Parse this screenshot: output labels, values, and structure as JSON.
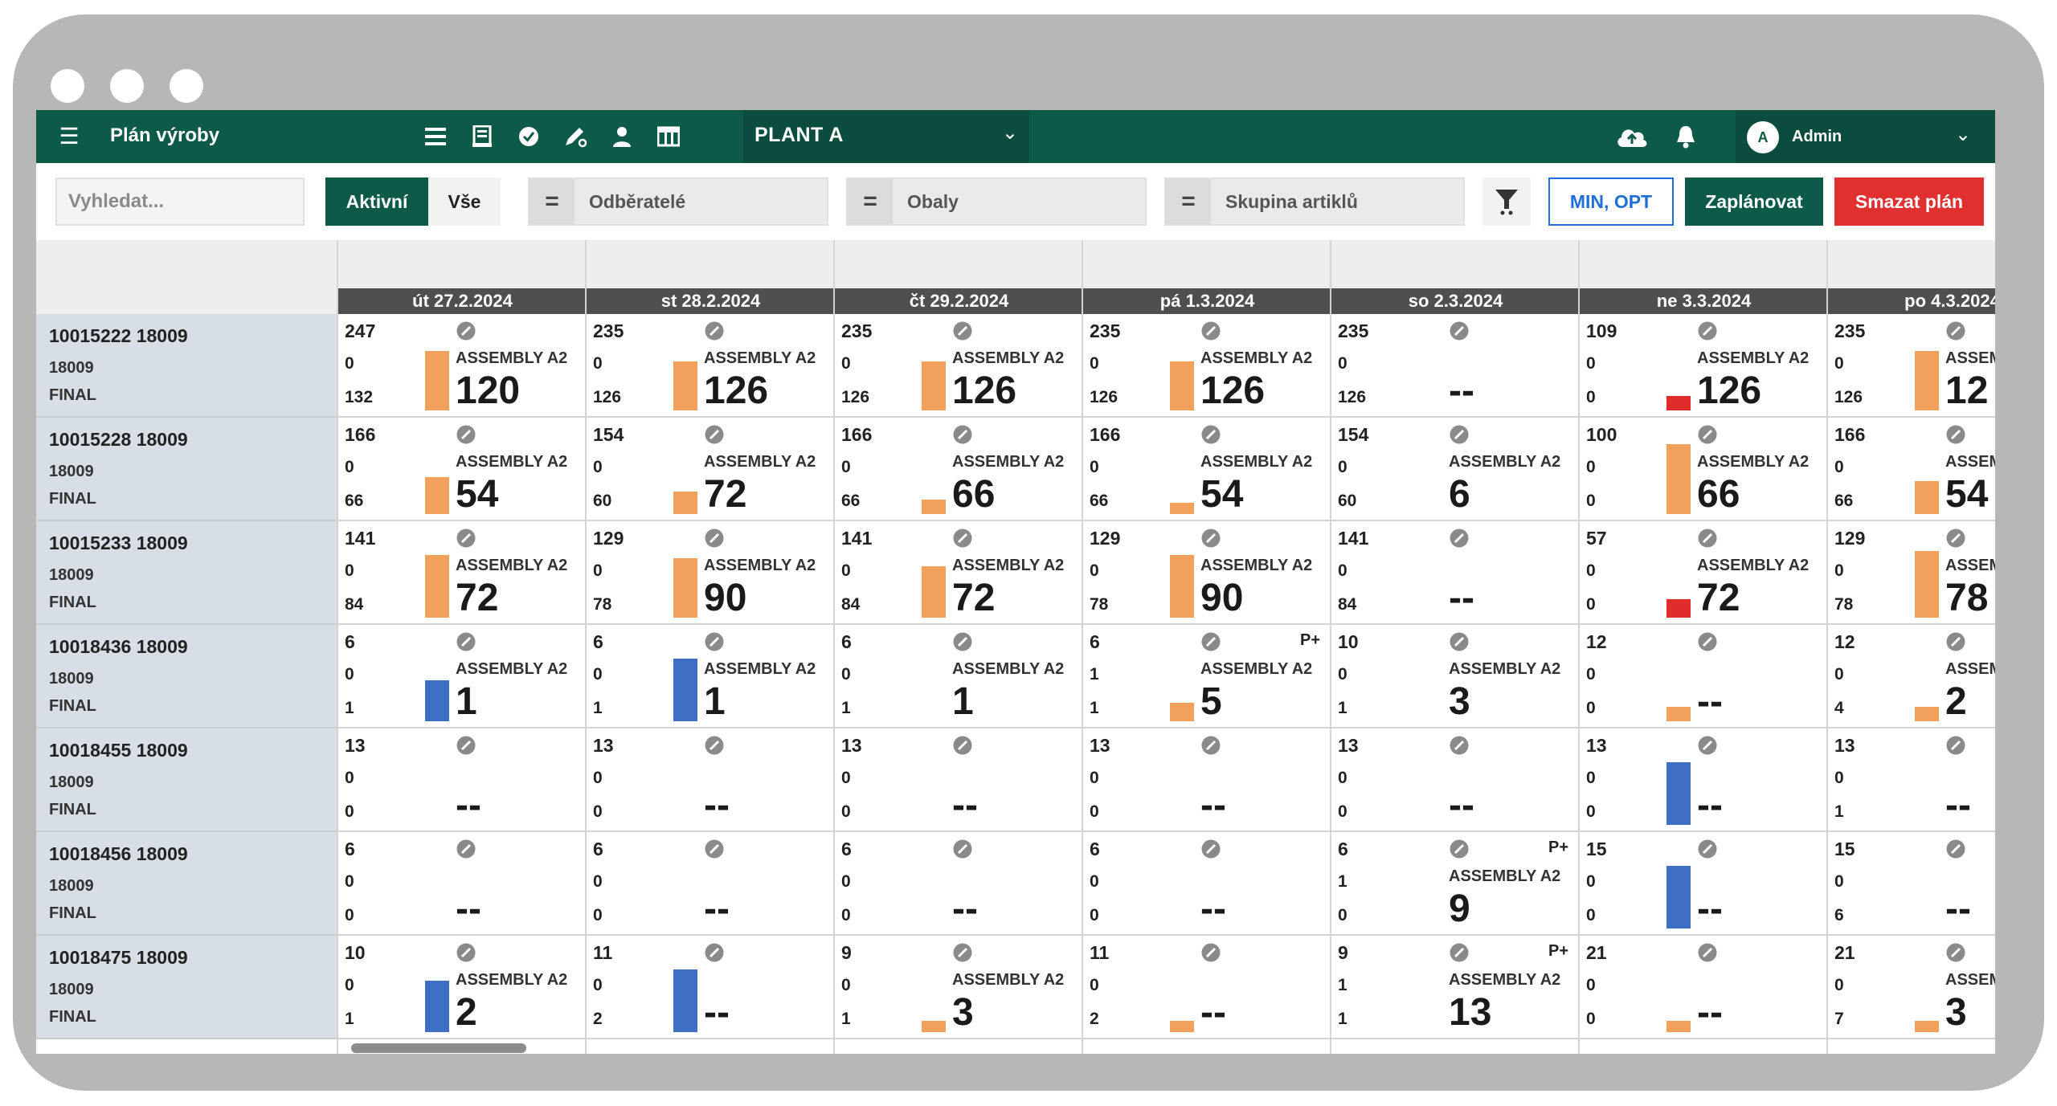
{
  "header": {
    "menu_icon": "hamburger-menu-icon",
    "title": "Plán výroby",
    "toolbar_icons": [
      "list-icon",
      "document-icon",
      "check-circle-icon",
      "edit-pen-icon",
      "user-icon",
      "table-icon"
    ],
    "plant": "PLANT A",
    "cloud_icon": "cloud-upload-icon",
    "bell_icon": "bell-icon",
    "user_initial": "A",
    "user_name": "Admin"
  },
  "toolbar": {
    "search_placeholder": "Vyhledat...",
    "active_label": "Aktivní",
    "all_label": "Vše",
    "filter_customers": "Odběratelé",
    "filter_packaging": "Obaly",
    "filter_group": "Skupina artiklů",
    "minopt_label": "MIN, OPT",
    "plan_label": "Zaplánovat",
    "delete_label": "Smazat plán"
  },
  "colors": {
    "primary_green": "#0e5a49",
    "orange": "#f2a15d",
    "blue": "#3f6fc4",
    "red": "#e02b2b",
    "danger_button": "#e03030",
    "outline_blue": "#1f6fd6"
  },
  "days": [
    "út 27.2.2024",
    "st 28.2.2024",
    "čt 29.2.2024",
    "pá 1.3.2024",
    "so 2.3.2024",
    "ne 3.3.2024",
    "po 4.3.2024"
  ],
  "rows": [
    {
      "id": "10015222 18009",
      "sub": "18009",
      "type": "FINAL",
      "cells": [
        {
          "a": "247",
          "b": "0",
          "c": "132",
          "asm": "ASSEMBLY A2",
          "big": "120",
          "bar": "orange",
          "level": 0.8,
          "pplus": ""
        },
        {
          "a": "235",
          "b": "0",
          "c": "126",
          "asm": "ASSEMBLY A2",
          "big": "126",
          "bar": "orange",
          "level": 0.66,
          "pplus": ""
        },
        {
          "a": "235",
          "b": "0",
          "c": "126",
          "asm": "ASSEMBLY A2",
          "big": "126",
          "bar": "orange",
          "level": 0.66,
          "pplus": ""
        },
        {
          "a": "235",
          "b": "0",
          "c": "126",
          "asm": "ASSEMBLY A2",
          "big": "126",
          "bar": "orange",
          "level": 0.66,
          "pplus": ""
        },
        {
          "a": "235",
          "b": "0",
          "c": "126",
          "asm": "",
          "big": "--",
          "bar": "",
          "level": 0,
          "pplus": ""
        },
        {
          "a": "109",
          "b": "0",
          "c": "0",
          "asm": "ASSEMBLY A2",
          "big": "126",
          "bar": "red",
          "level": 0.2,
          "pplus": ""
        },
        {
          "a": "235",
          "b": "0",
          "c": "126",
          "asm": "ASSEM",
          "big": "12",
          "bar": "orange",
          "level": 0.8,
          "pplus": ""
        }
      ]
    },
    {
      "id": "10015228 18009",
      "sub": "18009",
      "type": "FINAL",
      "cells": [
        {
          "a": "166",
          "b": "0",
          "c": "66",
          "asm": "ASSEMBLY A2",
          "big": "54",
          "bar": "orange",
          "level": 0.5,
          "pplus": ""
        },
        {
          "a": "154",
          "b": "0",
          "c": "60",
          "asm": "ASSEMBLY A2",
          "big": "72",
          "bar": "orange",
          "level": 0.3,
          "pplus": ""
        },
        {
          "a": "166",
          "b": "0",
          "c": "66",
          "asm": "ASSEMBLY A2",
          "big": "66",
          "bar": "orange",
          "level": 0.2,
          "pplus": ""
        },
        {
          "a": "166",
          "b": "0",
          "c": "66",
          "asm": "ASSEMBLY A2",
          "big": "54",
          "bar": "orange",
          "level": 0.15,
          "pplus": ""
        },
        {
          "a": "154",
          "b": "0",
          "c": "60",
          "asm": "ASSEMBLY A2",
          "big": "6",
          "bar": "",
          "level": 0,
          "pplus": ""
        },
        {
          "a": "100",
          "b": "0",
          "c": "0",
          "asm": "ASSEMBLY A2",
          "big": "66",
          "bar": "orange",
          "level": 0.95,
          "pplus": ""
        },
        {
          "a": "166",
          "b": "0",
          "c": "66",
          "asm": "ASSEM",
          "big": "54",
          "bar": "orange",
          "level": 0.45,
          "pplus": ""
        }
      ]
    },
    {
      "id": "10015233 18009",
      "sub": "18009",
      "type": "FINAL",
      "cells": [
        {
          "a": "141",
          "b": "0",
          "c": "84",
          "asm": "ASSEMBLY A2",
          "big": "72",
          "bar": "orange",
          "level": 0.85,
          "pplus": ""
        },
        {
          "a": "129",
          "b": "0",
          "c": "78",
          "asm": "ASSEMBLY A2",
          "big": "90",
          "bar": "orange",
          "level": 0.8,
          "pplus": ""
        },
        {
          "a": "141",
          "b": "0",
          "c": "84",
          "asm": "ASSEMBLY A2",
          "big": "72",
          "bar": "orange",
          "level": 0.7,
          "pplus": ""
        },
        {
          "a": "129",
          "b": "0",
          "c": "78",
          "asm": "ASSEMBLY A2",
          "big": "90",
          "bar": "orange",
          "level": 0.85,
          "pplus": ""
        },
        {
          "a": "141",
          "b": "0",
          "c": "84",
          "asm": "",
          "big": "--",
          "bar": "",
          "level": 0,
          "pplus": ""
        },
        {
          "a": "57",
          "b": "0",
          "c": "0",
          "asm": "ASSEMBLY A2",
          "big": "72",
          "bar": "red",
          "level": 0.25,
          "pplus": ""
        },
        {
          "a": "129",
          "b": "0",
          "c": "78",
          "asm": "ASSEM",
          "big": "78",
          "bar": "orange",
          "level": 0.9,
          "pplus": ""
        }
      ]
    },
    {
      "id": "10018436 18009",
      "sub": "18009",
      "type": "FINAL",
      "cells": [
        {
          "a": "6",
          "b": "0",
          "c": "1",
          "asm": "ASSEMBLY A2",
          "big": "1",
          "bar": "blue",
          "level": 0.55,
          "pplus": ""
        },
        {
          "a": "6",
          "b": "0",
          "c": "1",
          "asm": "ASSEMBLY A2",
          "big": "1",
          "bar": "blue",
          "level": 0.85,
          "pplus": ""
        },
        {
          "a": "6",
          "b": "0",
          "c": "1",
          "asm": "ASSEMBLY A2",
          "big": "1",
          "bar": "",
          "level": 0,
          "pplus": ""
        },
        {
          "a": "6",
          "b": "1",
          "c": "1",
          "asm": "ASSEMBLY A2",
          "big": "5",
          "bar": "orange",
          "level": 0.25,
          "pplus": "P+"
        },
        {
          "a": "10",
          "b": "0",
          "c": "1",
          "asm": "ASSEMBLY A2",
          "big": "3",
          "bar": "",
          "level": 0,
          "pplus": ""
        },
        {
          "a": "12",
          "b": "0",
          "c": "0",
          "asm": "",
          "big": "--",
          "bar": "orange",
          "level": 0.2,
          "pplus": ""
        },
        {
          "a": "12",
          "b": "0",
          "c": "4",
          "asm": "ASSEM",
          "big": "2",
          "bar": "orange",
          "level": 0.2,
          "pplus": ""
        }
      ]
    },
    {
      "id": "10018455 18009",
      "sub": "18009",
      "type": "FINAL",
      "cells": [
        {
          "a": "13",
          "b": "0",
          "c": "0",
          "asm": "",
          "big": "--",
          "bar": "",
          "level": 0,
          "pplus": ""
        },
        {
          "a": "13",
          "b": "0",
          "c": "0",
          "asm": "",
          "big": "--",
          "bar": "",
          "level": 0,
          "pplus": ""
        },
        {
          "a": "13",
          "b": "0",
          "c": "0",
          "asm": "",
          "big": "--",
          "bar": "",
          "level": 0,
          "pplus": ""
        },
        {
          "a": "13",
          "b": "0",
          "c": "0",
          "asm": "",
          "big": "--",
          "bar": "",
          "level": 0,
          "pplus": ""
        },
        {
          "a": "13",
          "b": "0",
          "c": "0",
          "asm": "",
          "big": "--",
          "bar": "",
          "level": 0,
          "pplus": ""
        },
        {
          "a": "13",
          "b": "0",
          "c": "0",
          "asm": "",
          "big": "--",
          "bar": "blue",
          "level": 0.85,
          "pplus": ""
        },
        {
          "a": "13",
          "b": "0",
          "c": "1",
          "asm": "",
          "big": "--",
          "bar": "",
          "level": 0,
          "pplus": ""
        }
      ]
    },
    {
      "id": "10018456 18009",
      "sub": "18009",
      "type": "FINAL",
      "cells": [
        {
          "a": "6",
          "b": "0",
          "c": "0",
          "asm": "",
          "big": "--",
          "bar": "",
          "level": 0,
          "pplus": ""
        },
        {
          "a": "6",
          "b": "0",
          "c": "0",
          "asm": "",
          "big": "--",
          "bar": "",
          "level": 0,
          "pplus": ""
        },
        {
          "a": "6",
          "b": "0",
          "c": "0",
          "asm": "",
          "big": "--",
          "bar": "",
          "level": 0,
          "pplus": ""
        },
        {
          "a": "6",
          "b": "0",
          "c": "0",
          "asm": "",
          "big": "--",
          "bar": "",
          "level": 0,
          "pplus": ""
        },
        {
          "a": "6",
          "b": "1",
          "c": "0",
          "asm": "ASSEMBLY A2",
          "big": "9",
          "bar": "",
          "level": 0,
          "pplus": "P+"
        },
        {
          "a": "15",
          "b": "0",
          "c": "0",
          "asm": "",
          "big": "--",
          "bar": "blue",
          "level": 0.85,
          "pplus": ""
        },
        {
          "a": "15",
          "b": "0",
          "c": "6",
          "asm": "",
          "big": "--",
          "bar": "",
          "level": 0,
          "pplus": ""
        }
      ]
    },
    {
      "id": "10018475 18009",
      "sub": "18009",
      "type": "FINAL",
      "cells": [
        {
          "a": "10",
          "b": "0",
          "c": "1",
          "asm": "ASSEMBLY A2",
          "big": "2",
          "bar": "blue",
          "level": 0.7,
          "pplus": ""
        },
        {
          "a": "11",
          "b": "0",
          "c": "2",
          "asm": "",
          "big": "--",
          "bar": "blue",
          "level": 0.85,
          "pplus": ""
        },
        {
          "a": "9",
          "b": "0",
          "c": "1",
          "asm": "ASSEMBLY A2",
          "big": "3",
          "bar": "orange",
          "level": 0.15,
          "pplus": ""
        },
        {
          "a": "11",
          "b": "0",
          "c": "2",
          "asm": "",
          "big": "--",
          "bar": "orange",
          "level": 0.15,
          "pplus": ""
        },
        {
          "a": "9",
          "b": "1",
          "c": "1",
          "asm": "ASSEMBLY A2",
          "big": "13",
          "bar": "",
          "level": 0,
          "pplus": "P+"
        },
        {
          "a": "21",
          "b": "0",
          "c": "0",
          "asm": "",
          "big": "--",
          "bar": "orange",
          "level": 0.15,
          "pplus": ""
        },
        {
          "a": "21",
          "b": "0",
          "c": "7",
          "asm": "ASSEM",
          "big": "3",
          "bar": "orange",
          "level": 0.15,
          "pplus": ""
        }
      ]
    }
  ]
}
